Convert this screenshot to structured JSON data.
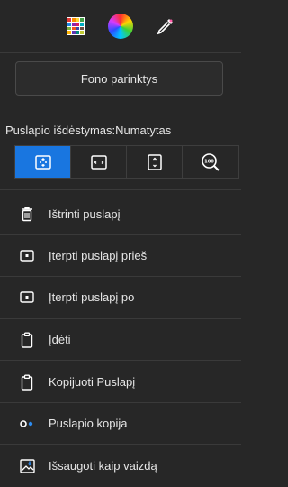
{
  "toolbar": {
    "icons": [
      "palette-grid-icon",
      "color-wheel-icon",
      "eyedropper-icon"
    ]
  },
  "background_button": {
    "label": "Fono parinktys"
  },
  "layout": {
    "label": "Puslapio išdėstymas:Numatytas",
    "options": [
      {
        "icon": "fit-page-icon",
        "active": true
      },
      {
        "icon": "fit-width-icon",
        "active": false
      },
      {
        "icon": "fit-height-icon",
        "active": false
      },
      {
        "icon": "zoom-100-icon",
        "active": false
      }
    ]
  },
  "menu": {
    "items": [
      {
        "icon": "trash-icon",
        "label": "Ištrinti puslapį"
      },
      {
        "icon": "insert-page-before-icon",
        "label": "Įterpti puslapį prieš"
      },
      {
        "icon": "insert-page-after-icon",
        "label": "Įterpti puslapį po"
      },
      {
        "icon": "clipboard-paste-icon",
        "label": "Įdėti"
      },
      {
        "icon": "clipboard-copy-icon",
        "label": "Kopijuoti Puslapį"
      },
      {
        "icon": "duplicate-page-icon",
        "label": "Puslapio kopija"
      },
      {
        "icon": "save-image-icon",
        "label": "Išsaugoti kaip vaizdą"
      }
    ]
  },
  "colors": {
    "background": "#272727",
    "accent": "#1976e0",
    "divider": "#3a3a3a",
    "text": "#e6e6e6"
  }
}
